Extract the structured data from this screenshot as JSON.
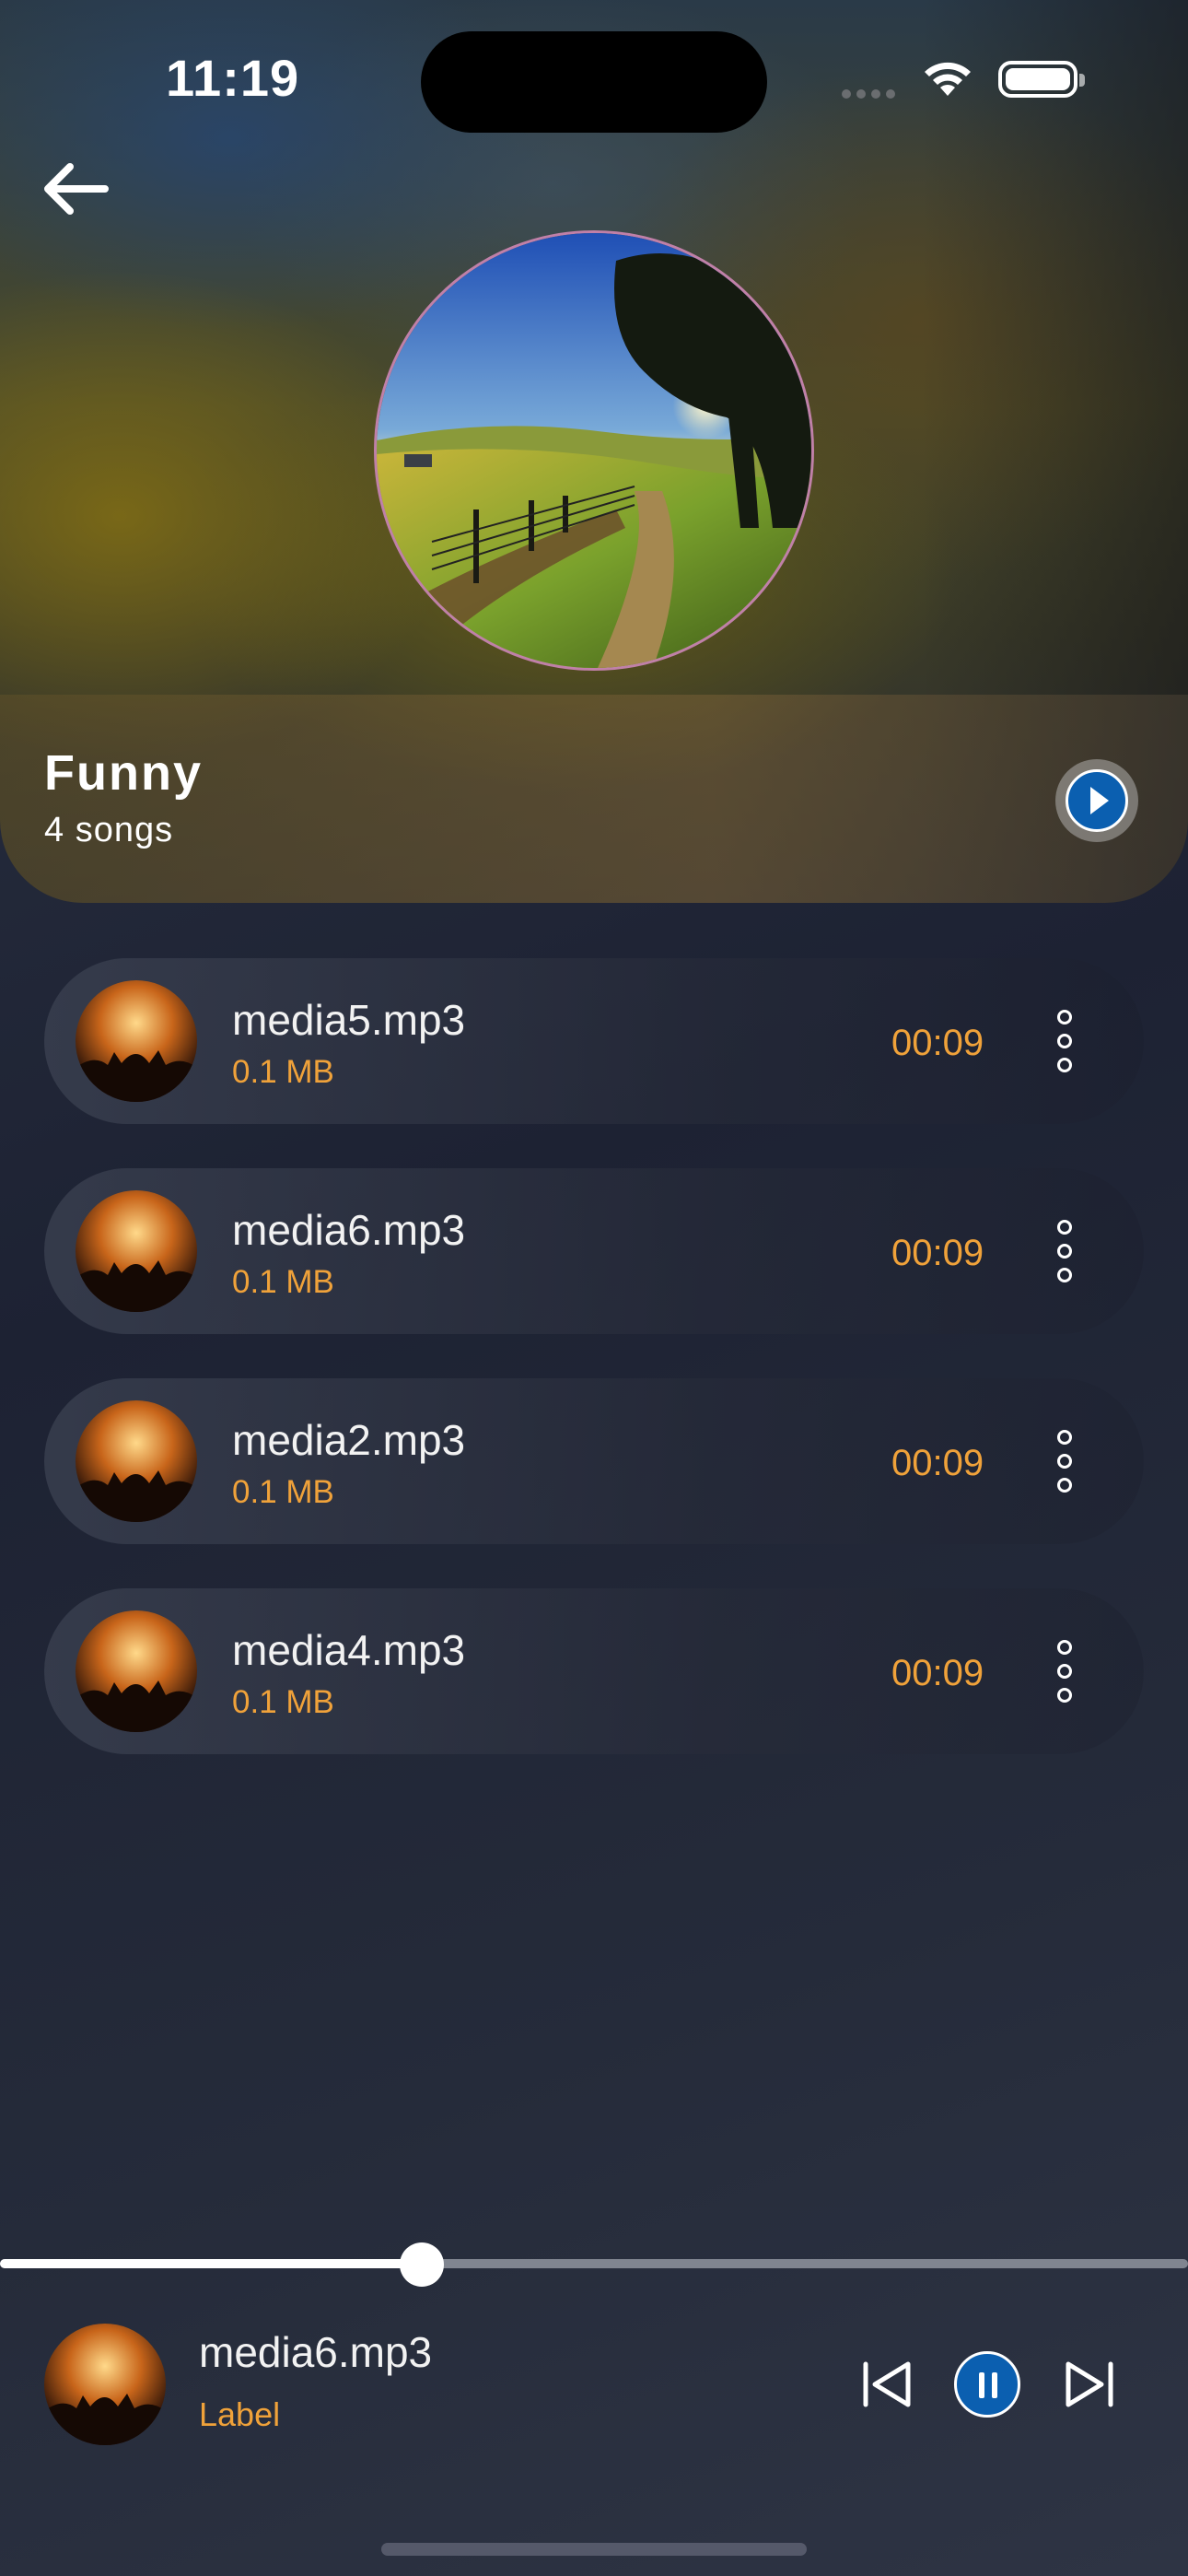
{
  "status_bar": {
    "time": "11:19"
  },
  "playlist": {
    "title": "Funny",
    "count_label": "4 songs"
  },
  "songs": [
    {
      "name": "media5.mp3",
      "size": "0.1 MB",
      "duration": "00:09"
    },
    {
      "name": "media6.mp3",
      "size": "0.1 MB",
      "duration": "00:09"
    },
    {
      "name": "media2.mp3",
      "size": "0.1 MB",
      "duration": "00:09"
    },
    {
      "name": "media4.mp3",
      "size": "0.1 MB",
      "duration": "00:09"
    }
  ],
  "now_playing": {
    "title": "media6.mp3",
    "subtitle": "Label",
    "progress": 0.355
  },
  "colors": {
    "accent": "#0b5fb0",
    "secondary_text": "#f0a23a"
  },
  "icons": [
    "back-arrow-icon",
    "play-icon",
    "more-vertical-icon",
    "previous-icon",
    "pause-icon",
    "next-icon",
    "wifi-icon",
    "battery-icon"
  ]
}
